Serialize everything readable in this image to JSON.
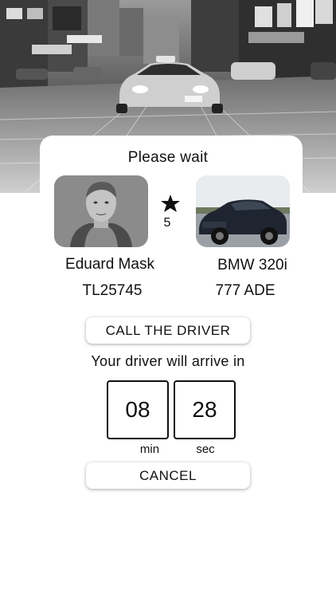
{
  "status": {
    "title": "Please  wait"
  },
  "driver": {
    "name": "Eduard Mask",
    "id": "TL25745",
    "rating": "5",
    "photo_icon": "driver-portrait"
  },
  "car": {
    "model": "BMW 320i",
    "plate": "777 ADE",
    "photo_icon": "car-photo"
  },
  "actions": {
    "call_label": "CALL THE  DRIVER",
    "cancel_label": "CANCEL"
  },
  "eta": {
    "label": "Your driver will arrive in",
    "minutes": "08",
    "seconds": "28",
    "min_unit": "min",
    "sec_unit": "sec"
  },
  "icons": {
    "rating": "star-icon"
  },
  "colors": {
    "text": "#111111",
    "background": "#ffffff",
    "button": "#ffffff"
  }
}
